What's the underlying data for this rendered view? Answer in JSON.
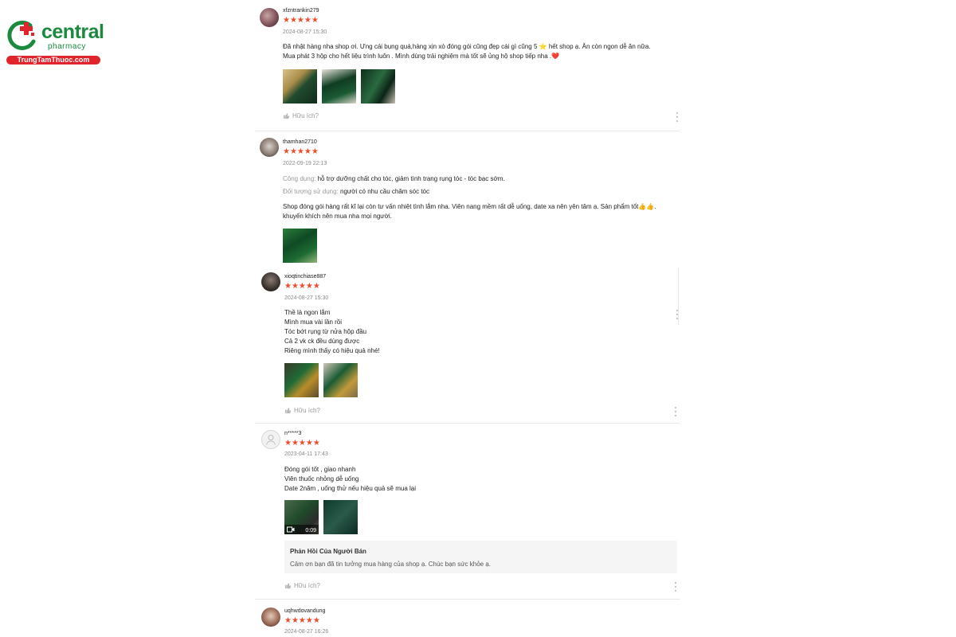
{
  "logo": {
    "name": "central",
    "sub": "pharmacy",
    "url": "TrungTamThuoc.com",
    "colors": {
      "green": "#1c8a3e",
      "red": "#e0242b"
    }
  },
  "colors": {
    "star": "#ee4d2d"
  },
  "reviews": [
    {
      "username": "xfzntrankin279",
      "stars": "★★★★★",
      "date": "2024-08-27 15:30",
      "lines": [
        "Đã nhật hàng nha shop ơi. Ưng cái bụng quá,hàng xịn xò đóng gói cũng đẹp cái gì cũng 5 ⭐ hết shop ạ. Ăn còn ngon dễ ăn nữa.",
        "Mua phát 3 hộp cho hết liệu trình luôn . Mình dùng trải nghiệm mà tốt sẽ ủng hộ shop tiếp nha .❤️"
      ],
      "helpful": "Hữu ích?"
    },
    {
      "username": "thamhan2710",
      "stars": "★★★★★",
      "date": "2022-09-19 22:13",
      "attr1_key": "Công dụng:",
      "attr1_val": "hỗ trợ dưỡng chất cho tóc, giảm tình trạng rụng tóc - tóc bạc sớm.",
      "attr2_key": "Đối tượng sử dụng:",
      "attr2_val": "người có nhu cầu chăm sóc tóc",
      "lines": [
        "Shop đóng gói hàng rất kĩ lại còn tư vấn nhiệt tình lắm nha. Viên nang mềm rất dễ uống, date xa nên yên tâm ạ. Sản phẩm tốt👍👍.",
        "khuyến khích nên mua nha mọi người."
      ]
    },
    {
      "username": "xioqtinchiase887",
      "stars": "★★★★★",
      "date": "2024-08-27 15:30",
      "lines": [
        "Thề là ngon lắm",
        "Mình mua vài lần rồi",
        "Tóc bớt rụng từ nửa hộp đầu",
        "Cả 2 vk ck đều dùng được",
        "Riêng mình thấy có hiệu quả nhé!"
      ],
      "helpful": "Hữu ích?"
    },
    {
      "username": "n*****3",
      "stars": "★★★★★",
      "date": "2023-04-11 17:43",
      "lines": [
        "Đóng gói tốt , giao nhanh",
        "Viên thuốc nhỏng dễ uống",
        "Date 2năm , uống thử nếu hiệu quả sẽ mua lại"
      ],
      "video_time": "0:09",
      "reply_title": "Phản Hồi Của Người Bán",
      "reply_text": "Cảm ơn bạn đã tin tưởng mua hàng của shop ạ. Chúc bạn sức khỏe ạ.",
      "helpful": "Hữu ích?"
    },
    {
      "username": "uqhwdovandung",
      "stars": "★★★★★",
      "date": "2024-08-27 16:26"
    }
  ]
}
